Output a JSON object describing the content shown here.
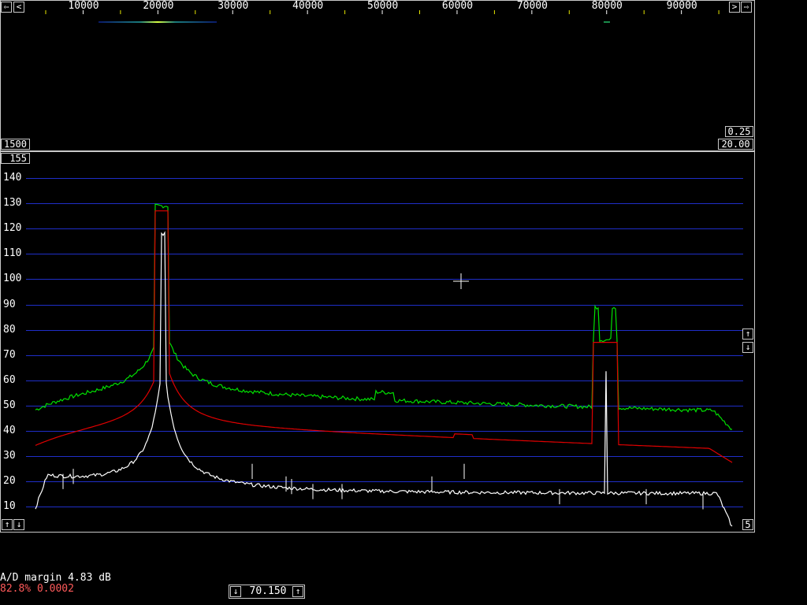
{
  "colors": {
    "grid": "#1f2ec8",
    "trace_avg": "#00e000",
    "trace_peak": "#e00000",
    "trace_cur": "#ffffff",
    "frame": "#c8c8c8",
    "status_red": "#ff5a5a"
  },
  "waterfall": {
    "x_ticks": [
      "10000",
      "20000",
      "30000",
      "40000",
      "50000",
      "60000",
      "70000",
      "80000",
      "90000"
    ],
    "scroll_left_icon": "arrow-left-icon",
    "scroll_right_icon": "arrow-right-icon",
    "left_value": "1500",
    "right_value_1": "0.25",
    "right_value_2": "20.00"
  },
  "spectrum": {
    "top_value": "155",
    "y_ticks": [
      "140",
      "130",
      "120",
      "110",
      "100",
      "90",
      "80",
      "70",
      "60",
      "50",
      "40",
      "30",
      "20",
      "10"
    ],
    "bottom_right_value": "5",
    "right_up_icon": "arrow-up-icon",
    "right_down_icon": "arrow-down-icon",
    "bottom_left_up_icon": "arrow-up-icon",
    "bottom_left_down_icon": "arrow-down-icon"
  },
  "status": {
    "ad_margin": "A/D margin 4.83 dB",
    "percent_line": "82.8% 0.0002"
  },
  "freq_control": {
    "value": "70.150",
    "down_icon": "arrow-down-icon",
    "up_icon": "arrow-up-icon"
  }
}
